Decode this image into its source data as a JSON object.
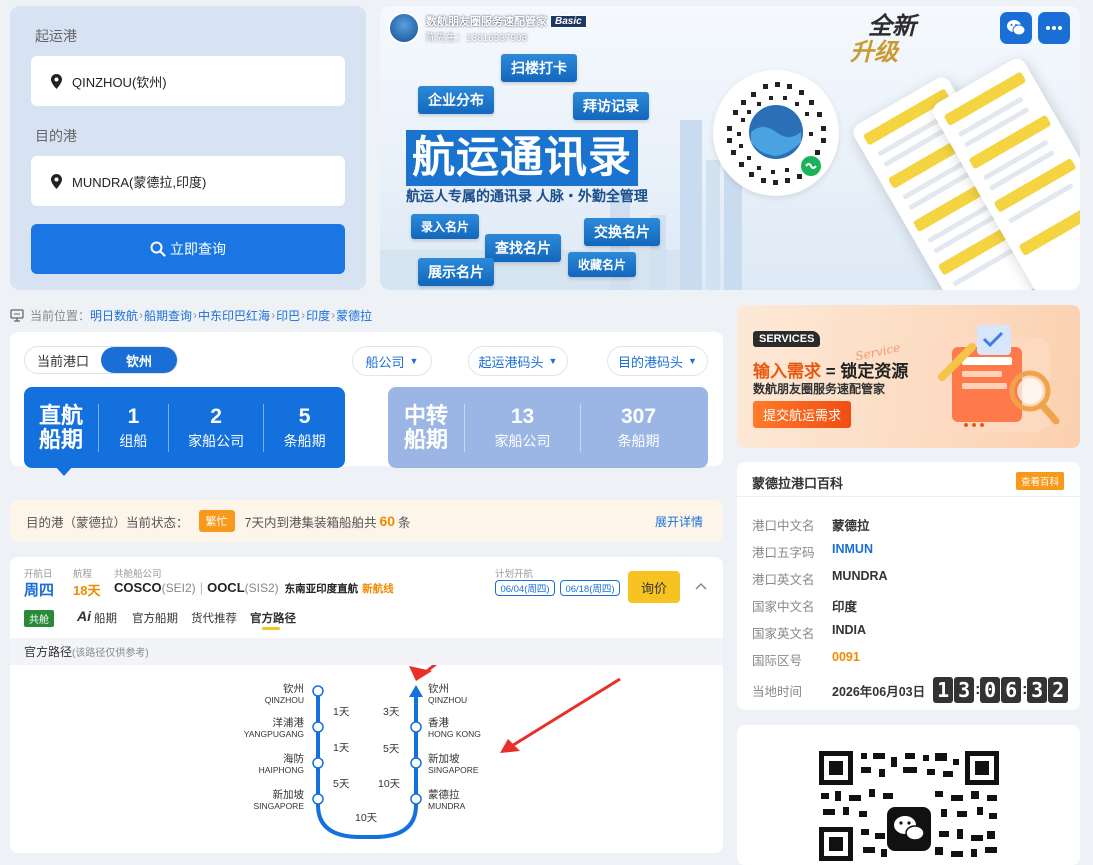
{
  "search": {
    "origin_label": "起运港",
    "origin_value": "QINZHOU(钦州)",
    "dest_label": "目的港",
    "dest_value": "MUNDRA(蒙德拉,印度)",
    "query_button": "立即查询"
  },
  "banner": {
    "app_name": "数航朋友圈服务速配管家",
    "app_badge": "Basic",
    "contact": "陈先生：13616937908",
    "upgrade_line1": "全新",
    "upgrade_line2": "升级",
    "tags": [
      "扫楼打卡",
      "企业分布",
      "拜访记录",
      "录入名片",
      "查找名片",
      "交换名片",
      "展示名片",
      "收藏名片"
    ],
    "title": "航运通讯录",
    "subtitle": "航运人专属的通讯录 人脉・外勤全管理"
  },
  "breadcrumb": {
    "prefix": "当前位置：",
    "items": [
      "明日数航",
      "船期查询",
      "中东印巴红海",
      "印巴",
      "印度",
      "蒙德拉"
    ]
  },
  "route_summary": {
    "current_port_label": "当前港口",
    "current_port_value": "钦州",
    "dropdowns": [
      "船公司",
      "起运港码头",
      "目的港码头"
    ],
    "direct": {
      "title_line1": "直航",
      "title_line2": "船期",
      "stats": [
        {
          "value": "1",
          "unit": "组船"
        },
        {
          "value": "2",
          "unit": "家船公司"
        },
        {
          "value": "5",
          "unit": "条船期"
        }
      ]
    },
    "transfer": {
      "title_line1": "中转",
      "title_line2": "船期",
      "stats": [
        {
          "value": "13",
          "unit": "家船公司"
        },
        {
          "value": "307",
          "unit": "条船期"
        }
      ]
    }
  },
  "status": {
    "prefix": "目的港（蒙德拉）当前状态：",
    "badge": "繁忙",
    "text_before": "7天内到港集装箱船舶共",
    "count": "60",
    "text_after": "条",
    "expand": "展开详情"
  },
  "voyage": {
    "labels": {
      "departure_day": "开航日",
      "transit": "航程",
      "carriers": "共舱船公司",
      "planned": "计划开航"
    },
    "departure_day": "周四",
    "transit_days": "18天",
    "carrier1": "COSCO",
    "carrier1_code": "(SEI2)",
    "divider": "|",
    "carrier2": "OOCL",
    "carrier2_code": "(SIS2)",
    "route_name": "东南亚印度直航",
    "new_line": "新航线",
    "dates": [
      "06/04(周四)",
      "06/18(周四)"
    ],
    "inquiry": "询价",
    "shared_badge": "共舱",
    "tabs": [
      "Ai",
      "船期",
      "官方船期",
      "货代推荐",
      "官方路径"
    ],
    "route_title": "官方路径",
    "route_note": "(该路径仅供参考)",
    "outbound": [
      {
        "cn": "钦州",
        "en": "QINZHOU"
      },
      {
        "cn": "洋浦港",
        "en": "YANGPUGANG"
      },
      {
        "cn": "海防",
        "en": "HAIPHONG"
      },
      {
        "cn": "新加坡",
        "en": "SINGAPORE"
      }
    ],
    "inbound": [
      {
        "cn": "钦州",
        "en": "QINZHOU"
      },
      {
        "cn": "香港",
        "en": "HONG KONG"
      },
      {
        "cn": "新加坡",
        "en": "SINGAPORE"
      },
      {
        "cn": "蒙德拉",
        "en": "MUNDRA"
      }
    ],
    "outbound_days": [
      "1天",
      "1天",
      "5天"
    ],
    "inbound_days": [
      "3天",
      "5天",
      "10天"
    ],
    "bottom_days": "10天"
  },
  "services_banner": {
    "badge": "SERVICES",
    "headline_a": "输入需求",
    "headline_eq": "=",
    "headline_b": "锁定资源",
    "script": "Service",
    "sub": "数航朋友圈服务速配管家",
    "button": "提交航运需求"
  },
  "wiki": {
    "title": "蒙德拉港口百科",
    "view_button": "查看百科",
    "rows": [
      {
        "k": "港口中文名",
        "v": "蒙德拉"
      },
      {
        "k": "港口五字码",
        "v": "INMUN"
      },
      {
        "k": "港口英文名",
        "v": "MUNDRA"
      },
      {
        "k": "国家中文名",
        "v": "印度"
      },
      {
        "k": "国家英文名",
        "v": "INDIA"
      },
      {
        "k": "国际区号",
        "v": "0091"
      }
    ],
    "time_label": "当地时间",
    "date": "2026年06月03日",
    "time_digits": [
      "1",
      "3",
      "0",
      "6",
      "3",
      "2"
    ]
  },
  "colors": {
    "primary": "#1a6fd6",
    "orange": "#f79a1c",
    "yellow": "#f7c323",
    "red_arrow": "#e8302a"
  }
}
